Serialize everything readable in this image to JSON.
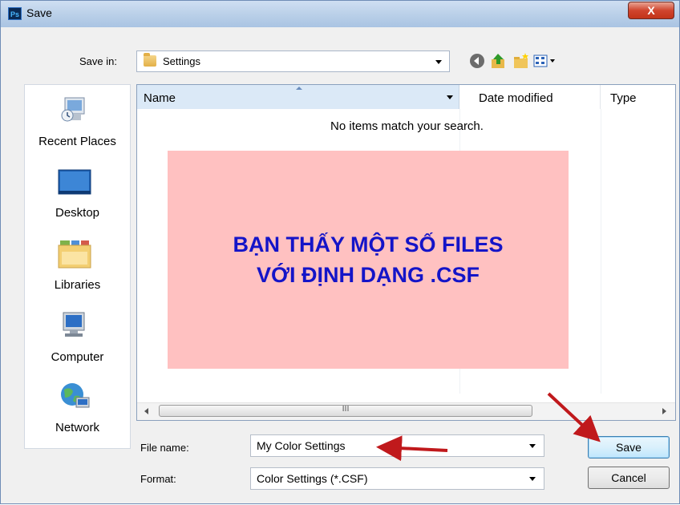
{
  "window": {
    "title": "Save",
    "app_icon_text": "Ps",
    "close_label": "X"
  },
  "toolbar": {
    "save_in_label": "Save in:",
    "save_in_value": "Settings",
    "icons": [
      "back-icon",
      "up-folder-icon",
      "new-folder-icon",
      "view-menu-icon"
    ]
  },
  "places": [
    {
      "label": "Recent Places",
      "icon": "recent-places-icon"
    },
    {
      "label": "Desktop",
      "icon": "desktop-icon"
    },
    {
      "label": "Libraries",
      "icon": "libraries-icon"
    },
    {
      "label": "Computer",
      "icon": "computer-icon"
    },
    {
      "label": "Network",
      "icon": "network-icon"
    }
  ],
  "file_list": {
    "columns": [
      "Name",
      "Date modified",
      "Type"
    ],
    "empty_message": "No items match your search.",
    "scroll_thumb_grip": "III"
  },
  "overlay": {
    "line1": "BẠN THẤY MỘT SỐ FILES",
    "line2": "VỚI ĐỊNH DẠNG .CSF"
  },
  "form": {
    "file_name_label": "File name:",
    "file_name_value": "My Color Settings",
    "format_label": "Format:",
    "format_value": "Color Settings (*.CSF)"
  },
  "buttons": {
    "save": "Save",
    "cancel": "Cancel"
  },
  "colors": {
    "overlay_bg": "#ffc1c1",
    "overlay_text": "#1414c8",
    "annotation_arrow": "#c0191c"
  }
}
